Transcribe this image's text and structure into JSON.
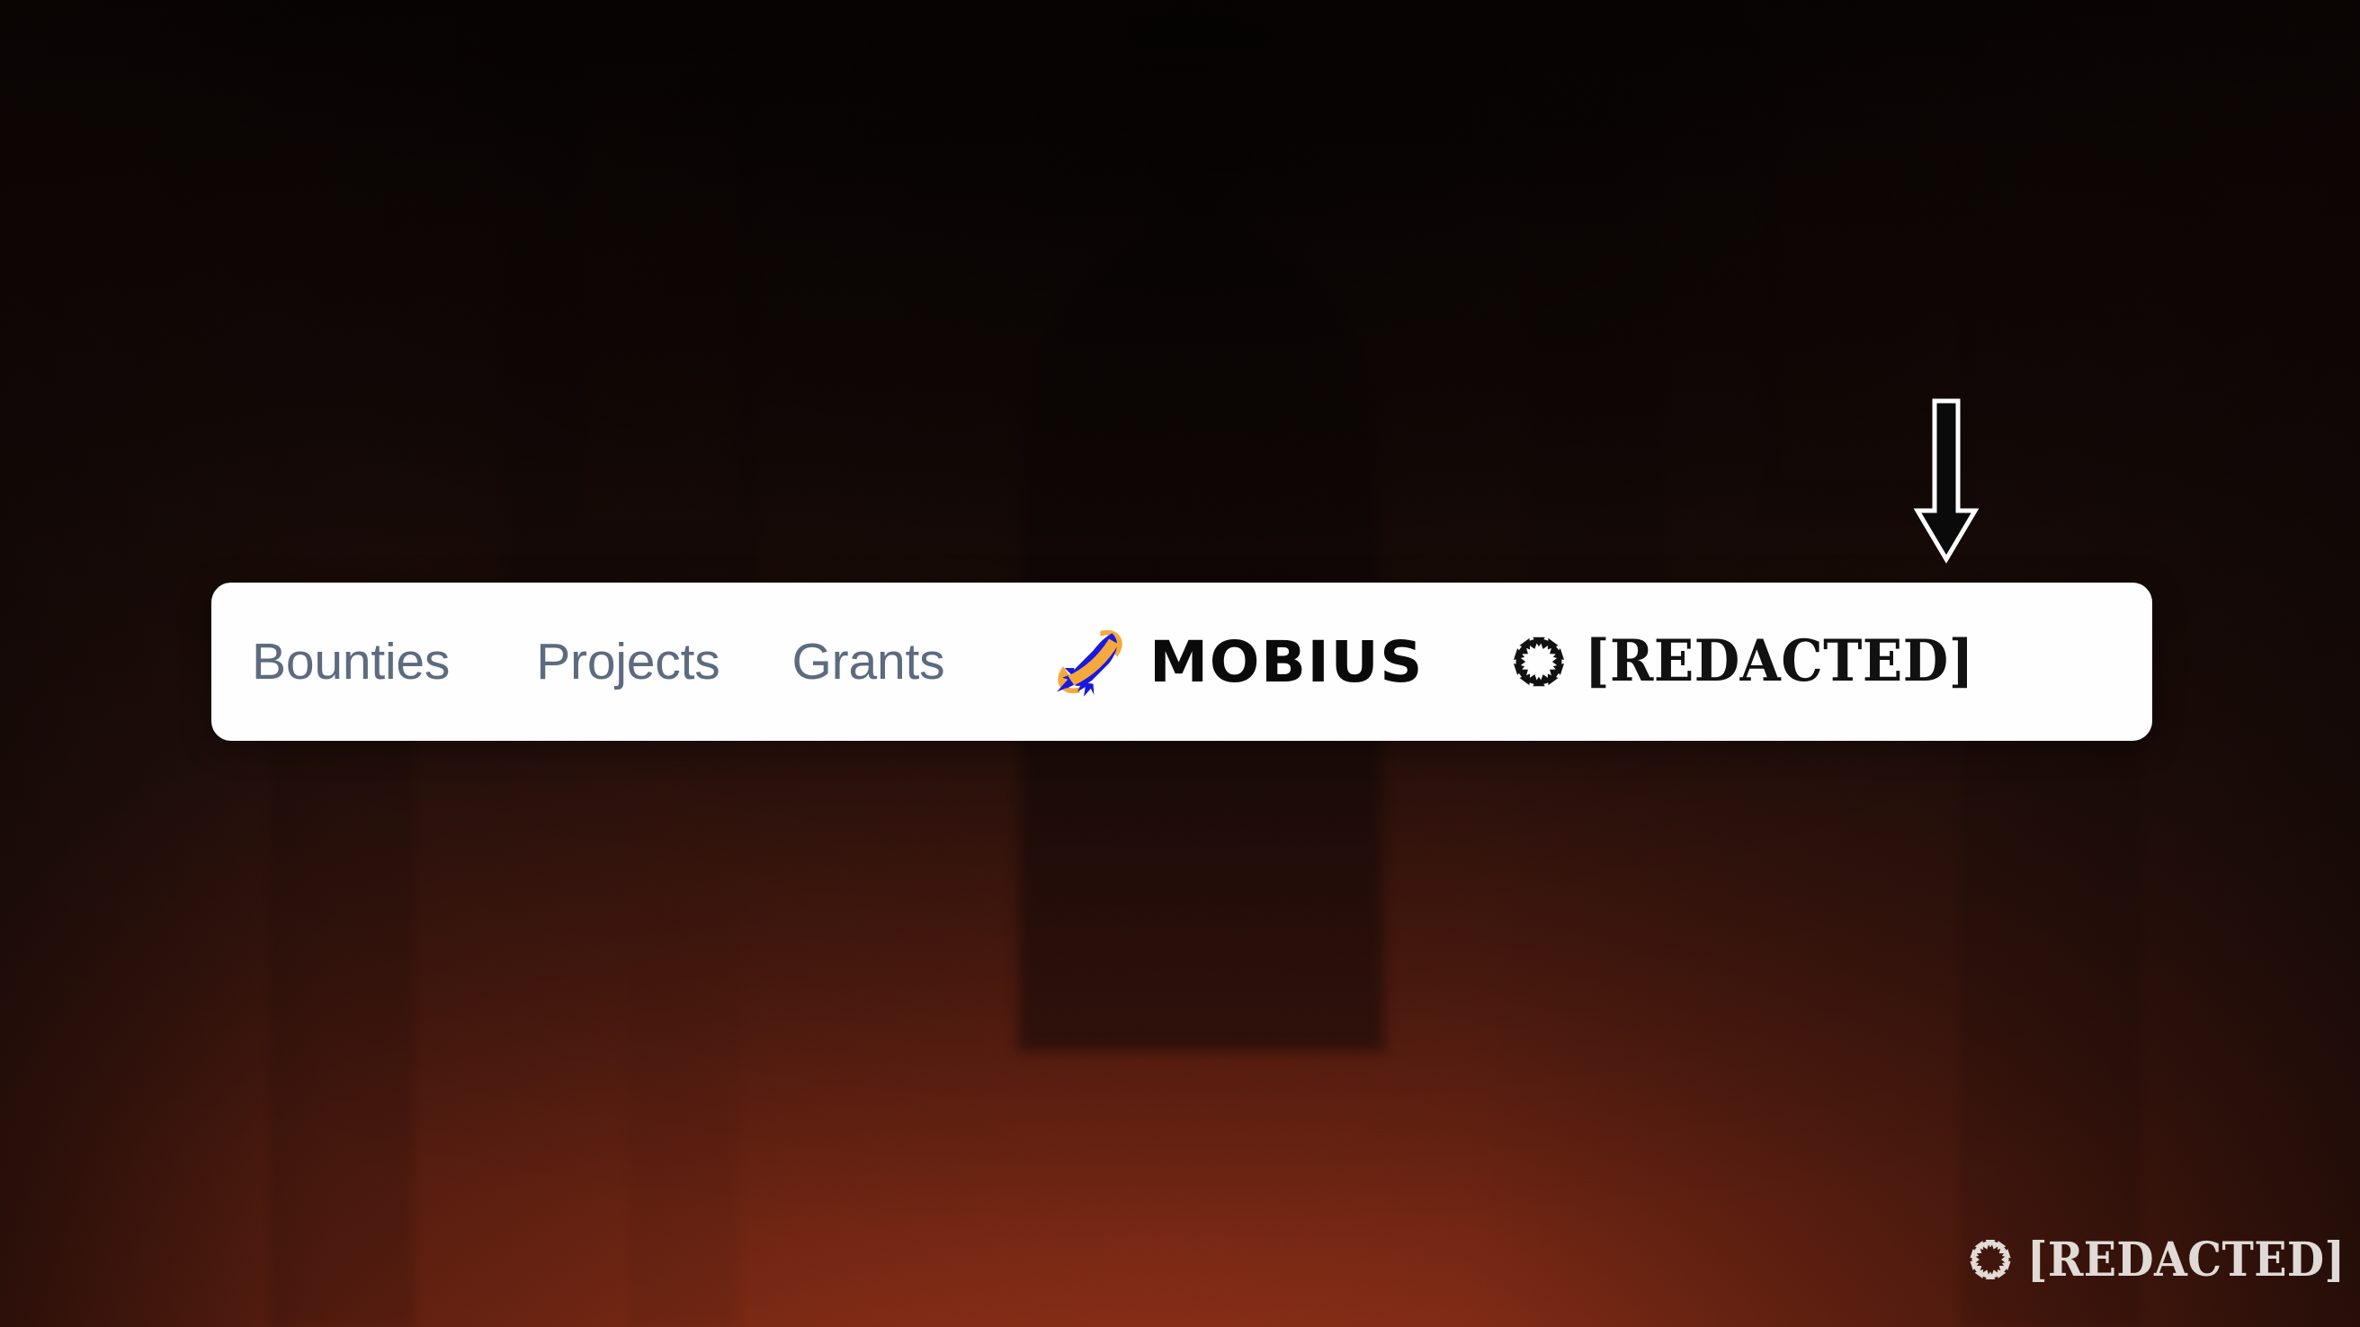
{
  "page": {
    "background": {
      "description": "dark red-brown gradient backdrop with faint silhouette of a figure in a wide-brim hat",
      "color_top": "#24100c",
      "color_bottom": "#a23a1c"
    }
  },
  "annotation": {
    "arrow": {
      "icon": "arrow-down-icon",
      "direction": "down",
      "fill": "#0a0a0a",
      "stroke": "#ffffff"
    }
  },
  "navbar": {
    "background": "#fefefe",
    "link_color": "#5d6b80",
    "links": [
      {
        "label": "Bounties"
      },
      {
        "label": "Projects"
      },
      {
        "label": "Grants"
      }
    ],
    "brands": [
      {
        "name": "mobius",
        "icon": "rocket-planet-icon",
        "wordmark": "MOBIUS",
        "icon_colors": {
          "rocket": "#1a18e0",
          "ring": "#f5a93c"
        },
        "wordmark_color": "#0a0a0a"
      },
      {
        "name": "redacted",
        "icon": "sunburst-icon",
        "wordmark": "[REDACTED]",
        "wordmark_color": "#111111"
      }
    ]
  },
  "watermark": {
    "icon": "sunburst-icon",
    "wordmark": "[REDACTED]",
    "color": "#eeeae6"
  }
}
